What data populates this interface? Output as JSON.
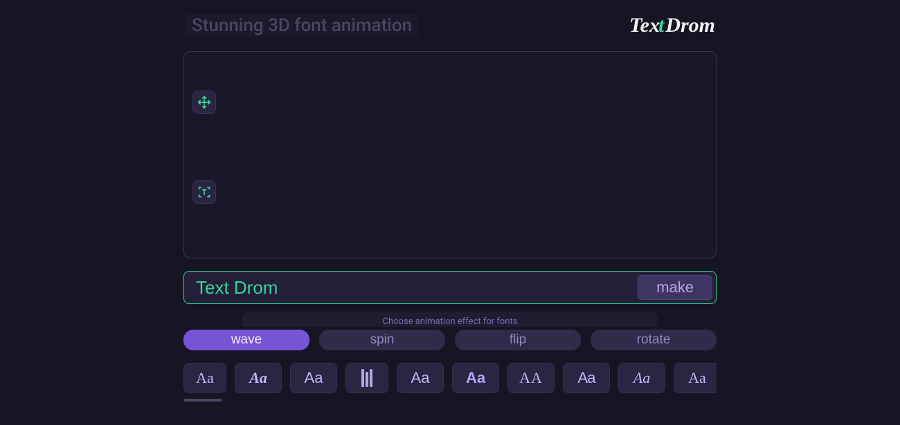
{
  "header": {
    "tagline": "Stunning 3D font animation",
    "logo": {
      "part1": "Tex",
      "part2": "t",
      "part3": "Drom"
    }
  },
  "canvas": {
    "tools": {
      "move": "move-tool",
      "text": "text-select-tool"
    }
  },
  "input": {
    "text_value": "Text Drom",
    "make_label": "make"
  },
  "effects": {
    "hint": "Choose animation effect for fonts",
    "items": [
      {
        "label": "wave",
        "active": true
      },
      {
        "label": "spin",
        "active": false
      },
      {
        "label": "flip",
        "active": false
      },
      {
        "label": "rotate",
        "active": false
      }
    ]
  },
  "fonts": {
    "items": [
      {
        "sample": "Aa",
        "style": "serif"
      },
      {
        "sample": "Aa",
        "style": "bolditalic"
      },
      {
        "sample": "Aa",
        "style": "thin"
      },
      {
        "sample": "",
        "style": "bars"
      },
      {
        "sample": "Aa",
        "style": "round"
      },
      {
        "sample": "Aa",
        "style": "boldround"
      },
      {
        "sample": "AA",
        "style": "smallcap"
      },
      {
        "sample": "Aa",
        "style": "condensed"
      },
      {
        "sample": "Aa",
        "style": "script"
      },
      {
        "sample": "Aa",
        "style": "hand"
      }
    ]
  }
}
